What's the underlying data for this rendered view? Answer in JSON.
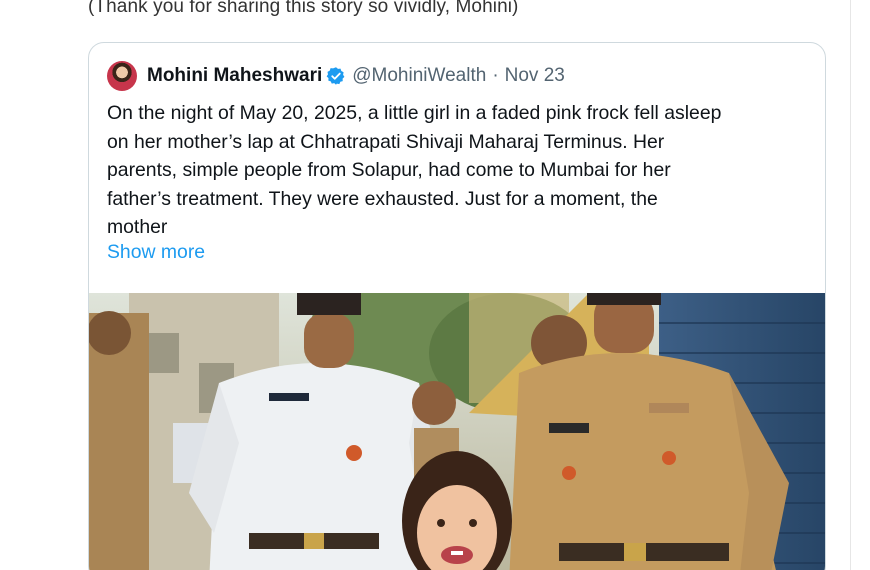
{
  "reply_text": "(Thank you for sharing this story so vividly,  Mohini)",
  "quoted_tweet": {
    "author_name": "Mohini Maheshwari",
    "handle": "@MohiniWealth",
    "separator": "·",
    "date": "Nov 23",
    "verified_icon": "verified-badge-icon",
    "body_lines": [
      "On the night of May 20, 2025, a little girl in a faded pink frock fell asleep",
      "on her mother’s lap at Chhatrapati Shivaji Maharaj Terminus. Her",
      "parents, simple people from Solapur, had come to Mumbai for her",
      "father’s treatment. They were exhausted. Just for a moment, the",
      "mother"
    ],
    "show_more": "Show more"
  },
  "colors": {
    "text": "#0f1419",
    "muted": "#536471",
    "link": "#1d9bf0",
    "verified": "#1d9bf0",
    "border": "#cfd9de"
  }
}
